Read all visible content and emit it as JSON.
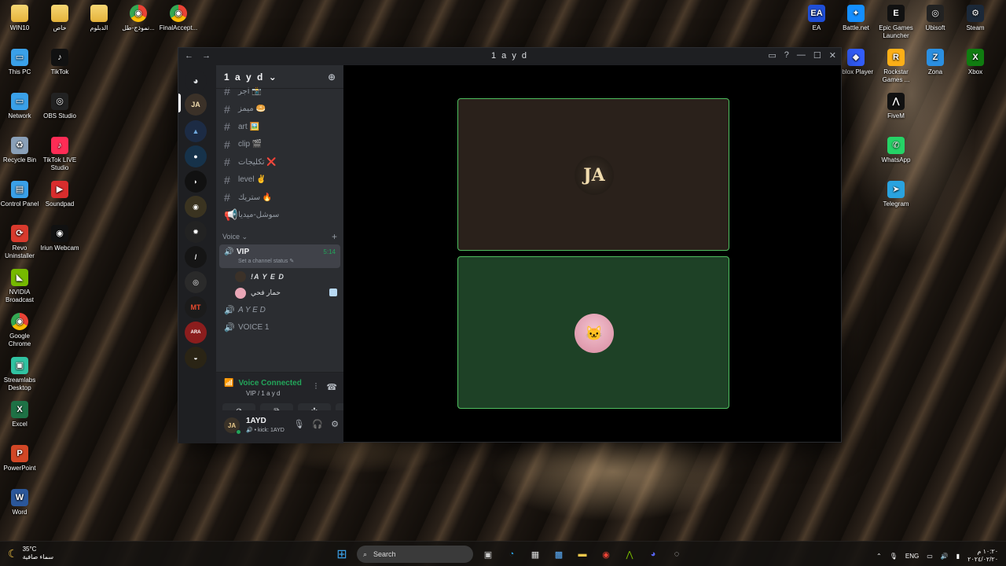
{
  "desktop": {
    "left_icons": [
      {
        "label": "WIN10",
        "icon": "folder-icon",
        "color": "#f2c94c"
      },
      {
        "label": "خاص",
        "icon": "folder-icon",
        "color": "#f2c94c"
      },
      {
        "label": "الدبلوم",
        "icon": "folder-icon",
        "color": "#f2c94c"
      },
      {
        "label": "نموذج-طل...",
        "icon": "chrome-icon",
        "color": "#ffffff"
      },
      {
        "label": "FinalAccept...",
        "icon": "chrome-icon",
        "color": "#ffffff"
      },
      {
        "label": "This PC",
        "icon": "monitor-icon",
        "color": "#3aa0e8"
      },
      {
        "label": "TikTok",
        "icon": "tiktok-icon",
        "color": "#111111"
      },
      {
        "label": "Network",
        "icon": "network-icon",
        "color": "#3aa0e8"
      },
      {
        "label": "OBS Studio",
        "icon": "obs-icon",
        "color": "#222222"
      },
      {
        "label": "Recycle Bin",
        "icon": "recycle-bin-icon",
        "color": "#8aa0b8"
      },
      {
        "label": "TikTok LIVE Studio",
        "icon": "tiktok-live-icon",
        "color": "#fe2c55"
      },
      {
        "label": "Control Panel",
        "icon": "control-panel-icon",
        "color": "#3aa0e8"
      },
      {
        "label": "Soundpad",
        "icon": "soundpad-icon",
        "color": "#d92d2d"
      },
      {
        "label": "Revo Uninstaller",
        "icon": "revo-icon",
        "color": "#d93a2d"
      },
      {
        "label": "Iriun Webcam",
        "icon": "webcam-icon",
        "color": "#111111"
      },
      {
        "label": "NVIDIA Broadcast",
        "icon": "nvidia-icon",
        "color": "#76b900"
      },
      {
        "label": "Google Chrome",
        "icon": "chrome-icon",
        "color": "#ffffff"
      },
      {
        "label": "Streamlabs Desktop",
        "icon": "streamlabs-icon",
        "color": "#31c3a2"
      },
      {
        "label": "Excel",
        "icon": "excel-icon",
        "color": "#1e7145"
      },
      {
        "label": "PowerPoint",
        "icon": "powerpoint-icon",
        "color": "#d24726"
      },
      {
        "label": "Word",
        "icon": "word-icon",
        "color": "#2b579a"
      }
    ],
    "right_icons": [
      {
        "label": "EA",
        "icon": "ea-icon",
        "color": "#1f4fd8"
      },
      {
        "label": "Battle.net",
        "icon": "battlenet-icon",
        "color": "#148eff"
      },
      {
        "label": "Epic Games Launcher",
        "icon": "epic-icon",
        "color": "#111111"
      },
      {
        "label": "Ubisoft",
        "icon": "ubisoft-icon",
        "color": "#222222"
      },
      {
        "label": "Steam",
        "icon": "steam-icon",
        "color": "#1b2838"
      },
      {
        "label": "oblox Player",
        "icon": "roblox-icon",
        "color": "#335fff"
      },
      {
        "label": "Rockstar Games ...",
        "icon": "rockstar-icon",
        "color": "#fcaf17"
      },
      {
        "label": "Zona",
        "icon": "zona-icon",
        "color": "#2b8fe0"
      },
      {
        "label": "Xbox",
        "icon": "xbox-icon",
        "color": "#107c10"
      },
      {
        "label": "FiveM",
        "icon": "fivem-icon",
        "color": "#111111"
      },
      {
        "label": "WhatsApp",
        "icon": "whatsapp-icon",
        "color": "#25d366"
      },
      {
        "label": "Telegram",
        "icon": "telegram-icon",
        "color": "#2aa3df"
      }
    ]
  },
  "window": {
    "title": "1 a y d",
    "back": "←",
    "forward": "→"
  },
  "server": {
    "name": "1 a y d",
    "text_channels": [
      {
        "name": "اجر 📸"
      },
      {
        "name": "ميمز 🥯"
      },
      {
        "name": "art 🖼️"
      },
      {
        "name": "clip 🎬"
      },
      {
        "name": "تكليجات ❌"
      },
      {
        "name": "level ✌️"
      },
      {
        "name": "ستريك 🔥"
      },
      {
        "name": "سوشل-ميديا"
      }
    ],
    "voice_category": "Voice",
    "active_voice": {
      "name": "VIP",
      "time": "5:14",
      "status": "Set a channel status ✎",
      "members": [
        {
          "name": "!A Y E D"
        },
        {
          "name": "حمار فحي"
        }
      ]
    },
    "other_voice": [
      {
        "name": "A Y E D"
      },
      {
        "name": "VOICE 1"
      }
    ]
  },
  "voice_panel": {
    "status": "Voice Connected",
    "sub": "VIP / 1 a y d"
  },
  "user": {
    "name": "1AYD",
    "sub": "🔊 • kick: 1AYD",
    "avatar_text": "JA"
  },
  "stage": {
    "tile1_avatar": "JA",
    "tile2_avatar": "🐱"
  },
  "taskbar": {
    "temp": "35°C",
    "weather": "سماء صافية",
    "search": "Search",
    "lang": "ENG",
    "time": "١٠:٢٠ م",
    "date": "٢٠٢٤/٠٢/٢٠"
  },
  "colors": {
    "accent_green": "#23a55a",
    "tile_border": "#4fbf5f"
  }
}
